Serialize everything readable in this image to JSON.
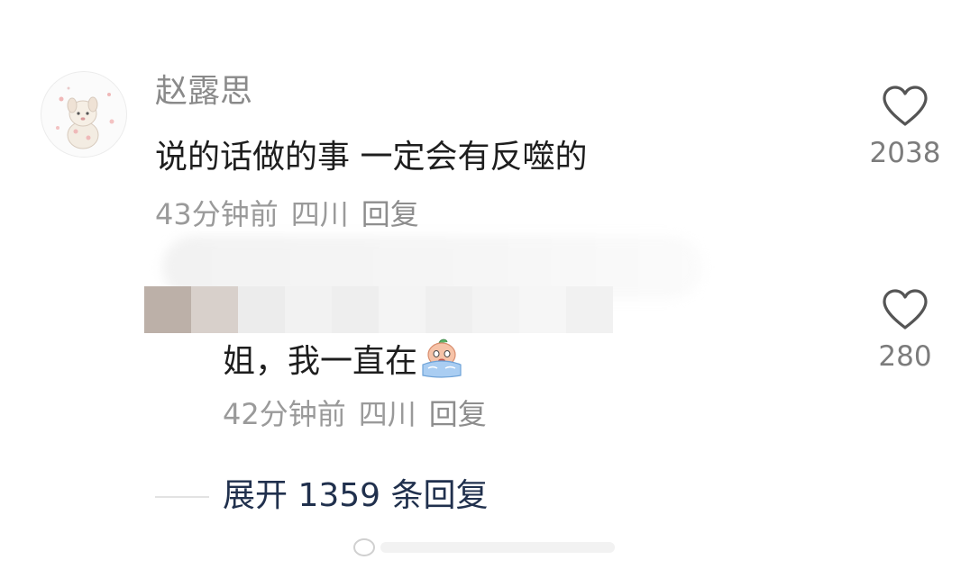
{
  "comment": {
    "username": "赵露思",
    "text": "说的话做的事 一定会有反噬的",
    "time": "43分钟前",
    "location": "四川",
    "reply_label": "回复",
    "likes": "2038",
    "avatar_icon": "cartoon-dog-avatar"
  },
  "reply": {
    "text": "姐，我一直在",
    "emoji_icon": "crying-peach-emoji",
    "time": "42分钟前",
    "location": "四川",
    "reply_label": "回复",
    "likes": "280"
  },
  "expand": {
    "label": "展开 1359 条回复"
  },
  "colors": {
    "text_primary": "#1e1e1e",
    "text_secondary": "#9a9a9a",
    "expand_link": "#20304d",
    "heart_stroke": "#555555"
  }
}
